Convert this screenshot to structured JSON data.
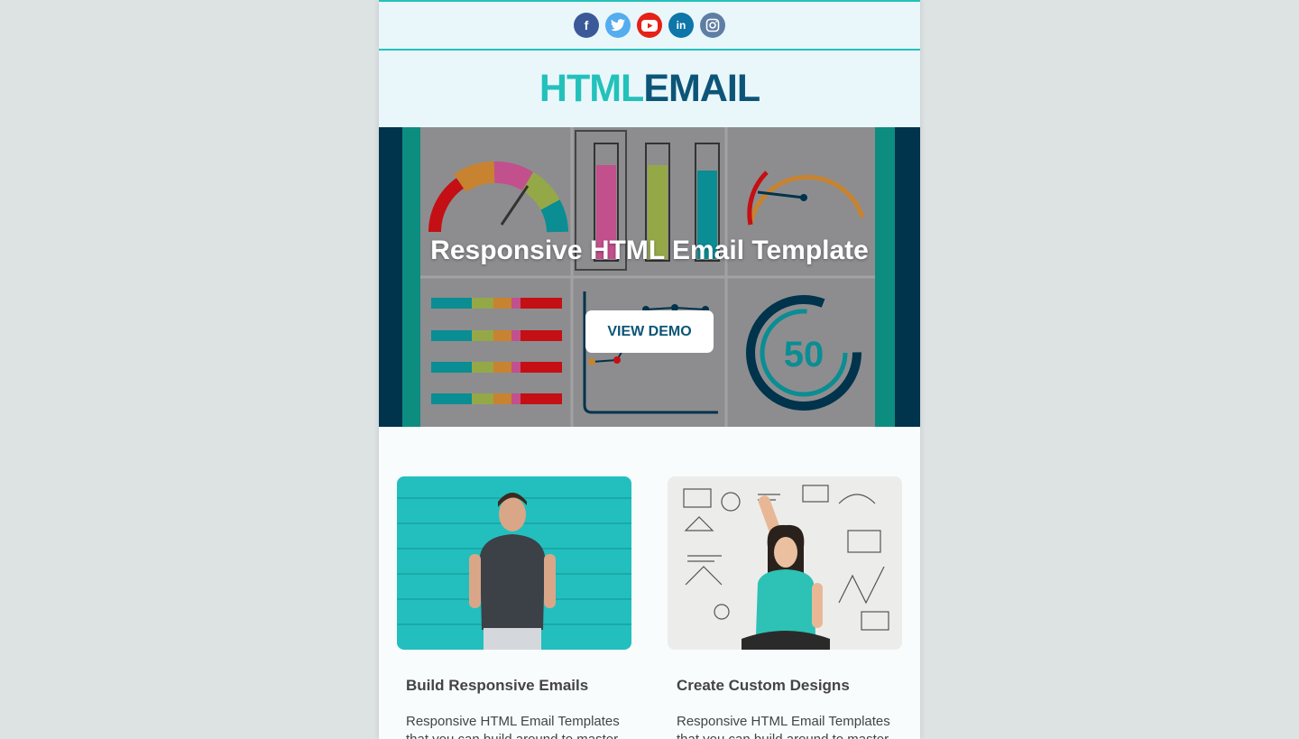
{
  "social": {
    "icons": [
      "facebook-icon",
      "twitter-icon",
      "youtube-icon",
      "linkedin-icon",
      "instagram-icon"
    ],
    "facebook_glyph": "f",
    "linkedin_glyph": "in"
  },
  "header": {
    "logo_part1": "HTML",
    "logo_part2": "EMAIL"
  },
  "hero": {
    "title": "Responsive HTML Email Template",
    "button_label": "VIEW DEMO",
    "gauge_number": "50"
  },
  "columns": [
    {
      "title": "Build Responsive Emails",
      "text": "Responsive HTML Email Templates that you can build around to master"
    },
    {
      "title": "Create Custom Designs",
      "text": "Responsive HTML Email Templates that you can build around to master"
    }
  ],
  "colors": {
    "accent": "#24c1bb",
    "brand_dark": "#0d5577",
    "hero_bg": "#00334c"
  }
}
